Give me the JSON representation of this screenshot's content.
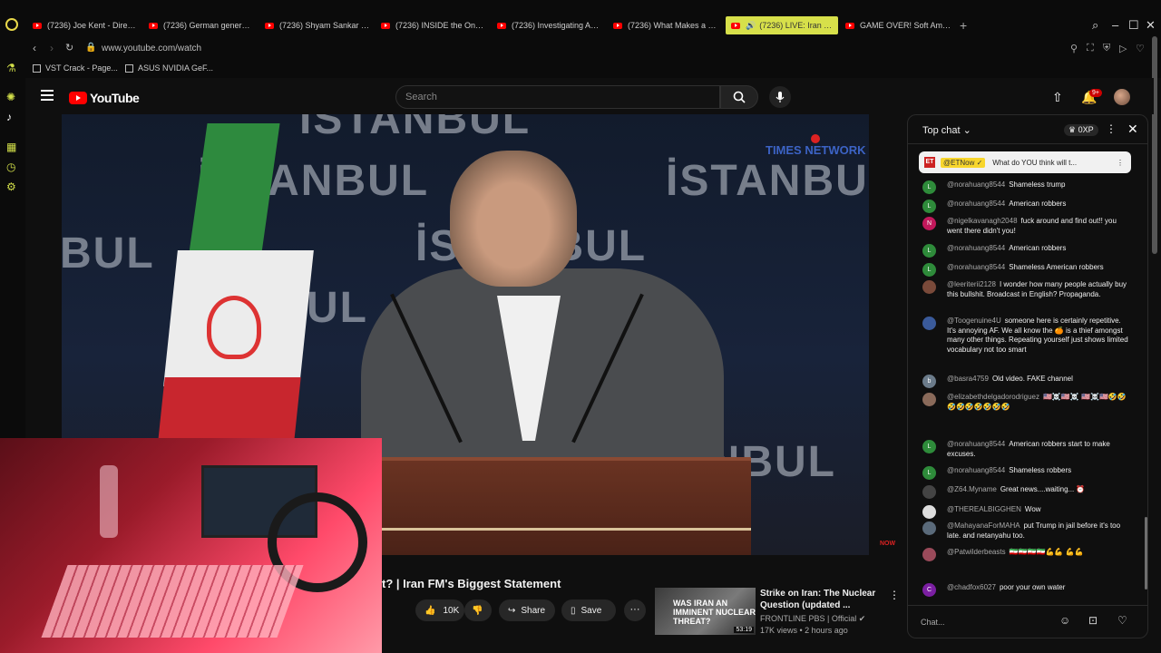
{
  "browser": {
    "tabs": [
      {
        "label": "(7236) Joe Kent - Director"
      },
      {
        "label": "(7236) German general w..."
      },
      {
        "label": "(7236) Shyam Sankar – A..."
      },
      {
        "label": "(7236) INSIDE the Ongoing..."
      },
      {
        "label": "(7236) Investigating Amer..."
      },
      {
        "label": "(7236) What Makes a $60..."
      },
      {
        "label": "(7236) LIVE: Iran Thre..."
      },
      {
        "label": "GAME OVER! Soft Ambien..."
      }
    ],
    "url": "www.youtube.com/watch",
    "bookmarks": [
      {
        "label": "VST Crack - Page..."
      },
      {
        "label": "ASUS NVIDIA GeF..."
      }
    ]
  },
  "youtube": {
    "logo_text": "YouTube",
    "search_placeholder": "Search",
    "notification_count": "9+"
  },
  "video": {
    "title": "t? | Iran FM's Biggest Statement",
    "bg_words": [
      "İSTANBUL",
      "İSTANBUL",
      "İSTANBUL",
      "BUL",
      "ANBUL",
      "İSTANBUL",
      "ANBUL"
    ],
    "broadcaster_logo": "TIMES NETWORK",
    "now_tag": "NOW",
    "likes": "10K",
    "share_label": "Share",
    "save_label": "Save"
  },
  "recommended": {
    "thumb_text": "WAS IRAN AN IMMINENT NUCLEAR THREAT?",
    "duration": "53:19",
    "title": "Strike on Iran: The Nuclear Question (updated ...",
    "channel": "FRONTLINE PBS | Official",
    "meta": "17K views • 2 hours ago"
  },
  "chat": {
    "mode_label": "Top chat",
    "xp_label": "0XP",
    "pinned": {
      "author": "@ETNow",
      "text": "What do YOU think will t..."
    },
    "messages": [
      {
        "initial": "L",
        "color": "#2e8b3a",
        "name": "@norahuang8544",
        "text": "Shameless trump"
      },
      {
        "initial": "L",
        "color": "#2e8b3a",
        "name": "@norahuang8544",
        "text": "American robbers"
      },
      {
        "initial": "N",
        "color": "#c2185b",
        "name": "@nigelkavanagh2048",
        "text": "fuck around and find out!! you went there didn't you!"
      },
      {
        "initial": "L",
        "color": "#2e8b3a",
        "name": "@norahuang8544",
        "text": "American robbers"
      },
      {
        "initial": "L",
        "color": "#2e8b3a",
        "name": "@norahuang8544",
        "text": "Shameless American robbers"
      },
      {
        "initial": "",
        "color": "#7a4a3a",
        "name": "@leeriterii2128",
        "text": "I wonder how many people actually buy this bullshit. Broadcast in English? Propaganda."
      },
      {
        "initial": "",
        "color": "#3a5a9a",
        "name": "@Toogenuine4U",
        "text": "someone here is certainly repetitive. It's annoying AF. We all know the 🍊 is a thief amongst many other things. Repeating yourself just shows limited vocabulary not too smart"
      },
      {
        "initial": "b",
        "color": "#6b7b8a",
        "name": "@basra4759",
        "text": "Old video. FAKE channel"
      },
      {
        "initial": "",
        "color": "#8a6a5a",
        "name": "@elizabethdelgadorodriguez",
        "text": "🇺🇸☠️🇺🇸☠️ 🇺🇸☠️🇺🇸🤣🤣🤣🤣🤣🤣🤣🤣🤣"
      },
      {
        "initial": "L",
        "color": "#2e8b3a",
        "name": "@norahuang8544",
        "text": "American robbers start to make excuses."
      },
      {
        "initial": "L",
        "color": "#2e8b3a",
        "name": "@norahuang8544",
        "text": "Shameless robbers"
      },
      {
        "initial": "",
        "color": "#444444",
        "name": "@Z64.Myname",
        "text": "Great news....waiting... ⏰"
      },
      {
        "initial": "",
        "color": "#dddddd",
        "name": "@THEREALBIGGHEN",
        "text": "Wow"
      },
      {
        "initial": "",
        "color": "#5a6a7a",
        "name": "@MahayanaForMAHA",
        "text": "put Trump in jail before it's too late. and netanyahu too."
      },
      {
        "initial": "",
        "color": "#9a4a5a",
        "name": "@Patwilderbeasts",
        "text": "🇮🇷🇮🇷🇮🇷🇮🇷💪💪 💪💪"
      },
      {
        "initial": "C",
        "color": "#7b1fa2",
        "name": "@chadfox6027",
        "text": "poor your own water"
      }
    ],
    "input_placeholder": "Chat..."
  }
}
